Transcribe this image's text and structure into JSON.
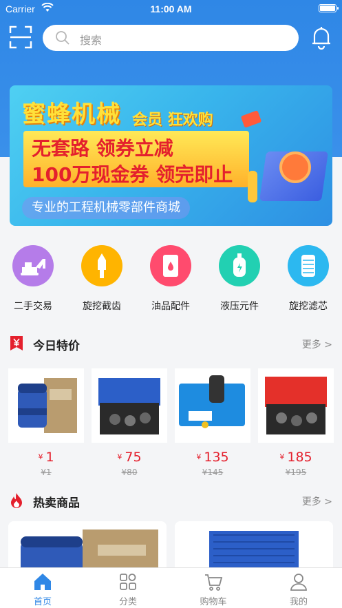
{
  "status_bar": {
    "carrier": "Carrier",
    "time": "11:00 AM"
  },
  "header": {
    "search_placeholder": "搜索"
  },
  "banner": {
    "brand": "蜜蜂机械",
    "promo": "会员 狂欢购",
    "line1": "无套路 领券立减",
    "line2": "100万现金券 领完即止",
    "tagline": "专业的工程机械零部件商城"
  },
  "categories": [
    {
      "label": "二手交易",
      "icon": "excavator-icon",
      "color": "#b57ce9"
    },
    {
      "label": "旋挖截齿",
      "icon": "drill-tooth-icon",
      "color": "#ffb400"
    },
    {
      "label": "油品配件",
      "icon": "oil-drum-icon",
      "color": "#ff4b6e"
    },
    {
      "label": "液压元件",
      "icon": "hydraulic-icon",
      "color": "#22d0b2"
    },
    {
      "label": "旋挖滤芯",
      "icon": "filter-icon",
      "color": "#2cb8f0"
    }
  ],
  "today_deals": {
    "title": "今日特价",
    "more": "更多 >",
    "currency": "¥",
    "items": [
      {
        "price": "1",
        "original": "¥1"
      },
      {
        "price": "75",
        "original": "¥80"
      },
      {
        "price": "135",
        "original": "¥145"
      },
      {
        "price": "185",
        "original": "¥195"
      }
    ]
  },
  "hot_products": {
    "title": "热卖商品",
    "more": "更多 >"
  },
  "tabbar": [
    {
      "label": "首页",
      "icon": "home-icon",
      "active": true
    },
    {
      "label": "分类",
      "icon": "category-icon",
      "active": false
    },
    {
      "label": "购物车",
      "icon": "cart-icon",
      "active": false
    },
    {
      "label": "我的",
      "icon": "user-icon",
      "active": false
    }
  ],
  "colors": {
    "primary": "#2f87e6",
    "price": "#e4202d",
    "brand_yellow": "#ffe13a"
  }
}
